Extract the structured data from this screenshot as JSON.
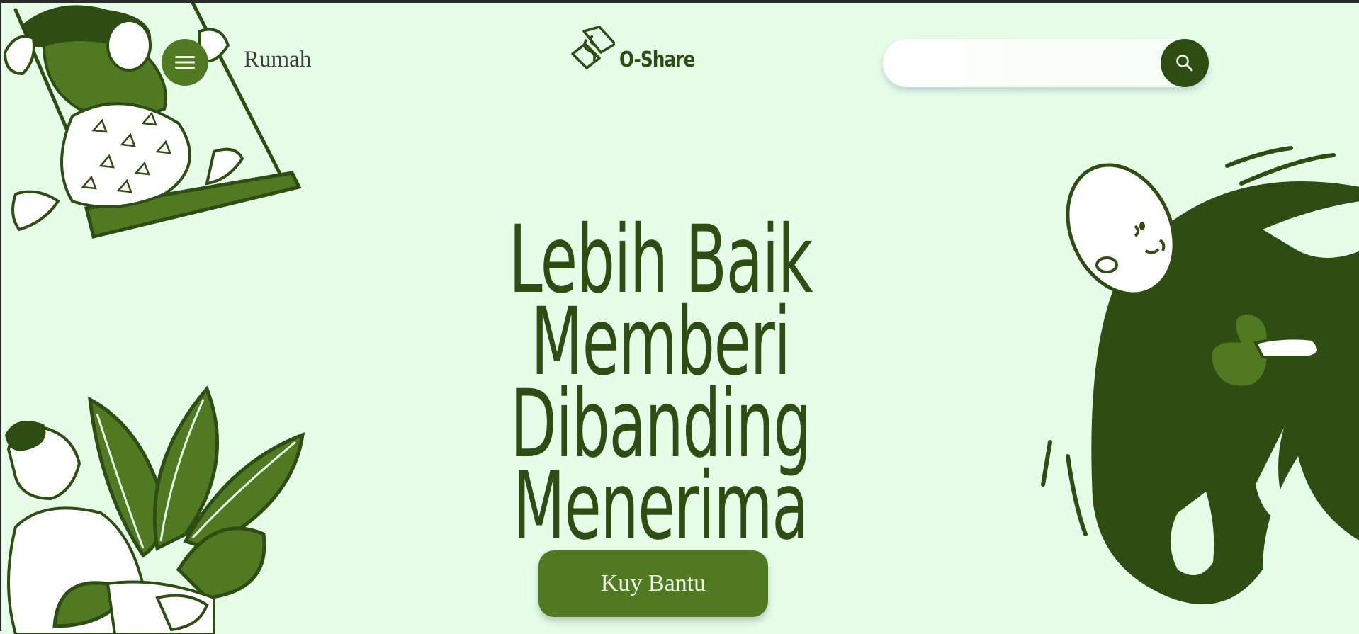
{
  "nav": {
    "home_label": "Rumah"
  },
  "brand": {
    "name": "O-Share",
    "logo_icon": "handshake-logo-icon"
  },
  "search": {
    "value": "",
    "placeholder": "",
    "button_icon": "search-icon"
  },
  "hero": {
    "line1": "Lebih Baik",
    "line2": "Memberi Dibanding",
    "line3": "Menerima",
    "cta_label": "Kuy Bantu"
  },
  "colors": {
    "background": "#e6fde8",
    "dark_green": "#2e4d12",
    "mid_green": "#4f7a21",
    "text_gray": "#3e3e3e"
  },
  "illustrations": [
    "girl-on-swing-illustration",
    "woman-with-plant-illustration",
    "man-hugging-heart-illustration"
  ]
}
